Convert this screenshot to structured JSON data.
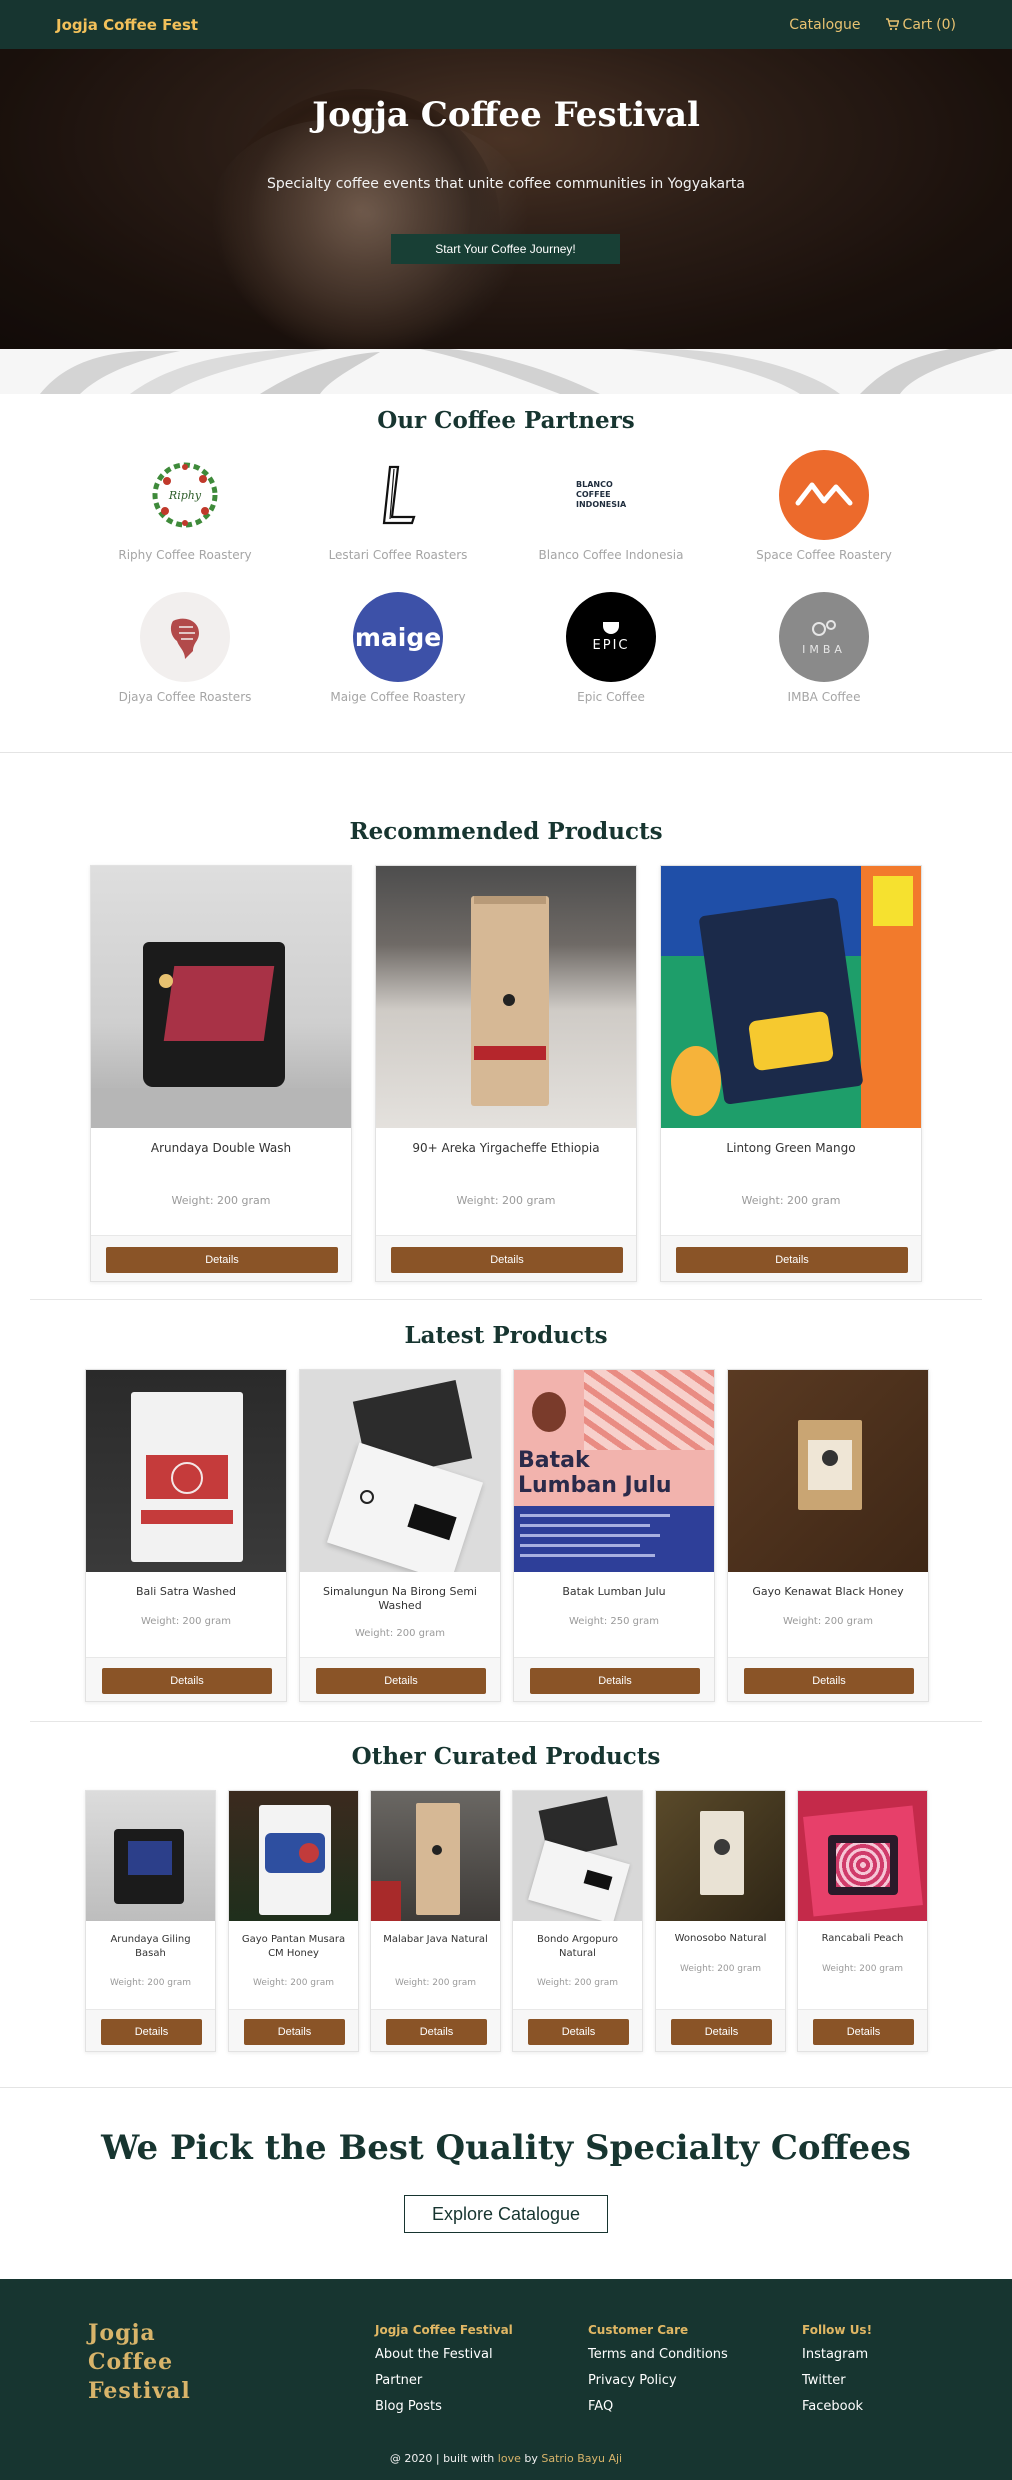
{
  "nav": {
    "brand": "Jogja Coffee Fest",
    "catalogue": "Catalogue",
    "cart_label": "Cart",
    "cart_count": "(0)"
  },
  "hero": {
    "title": "Jogja Coffee Festival",
    "subtitle": "Specialty coffee events that unite coffee communities in Yogyakarta",
    "button": "Start Your Coffee Journey!"
  },
  "partners": {
    "title": "Our Coffee Partners",
    "items": [
      {
        "name": "Riphy Coffee Roastery",
        "logo_text": "Riphy"
      },
      {
        "name": "Lestari Coffee Roasters",
        "logo_text": "L"
      },
      {
        "name": "Blanco Coffee Indonesia",
        "logo_text": "BLANCO COFFEE INDONESIA"
      },
      {
        "name": "Space Coffee Roastery",
        "logo_text": ""
      },
      {
        "name": "Djaya Coffee Roasters",
        "logo_text": ""
      },
      {
        "name": "Maige Coffee Roastery",
        "logo_text": "maige"
      },
      {
        "name": "Epic Coffee",
        "logo_text": "EPIC"
      },
      {
        "name": "IMBA Coffee",
        "logo_text": "IMBA"
      }
    ]
  },
  "recommended": {
    "title": "Recommended Products",
    "products": [
      {
        "name": "Arundaya Double Wash",
        "weight": "Weight: 200 gram",
        "button": "Details"
      },
      {
        "name": "90+ Areka Yirgacheffe Ethiopia",
        "weight": "Weight: 200 gram",
        "button": "Details"
      },
      {
        "name": "Lintong Green Mango",
        "weight": "Weight: 200 gram",
        "button": "Details"
      }
    ]
  },
  "latest": {
    "title": "Latest Products",
    "products": [
      {
        "name": "Bali Satra Washed",
        "weight": "Weight: 200 gram",
        "button": "Details"
      },
      {
        "name": "Simalungun Na Birong Semi Washed",
        "weight": "Weight: 200 gram",
        "button": "Details"
      },
      {
        "name": "Batak Lumban Julu",
        "weight": "Weight: 250 gram",
        "button": "Details"
      },
      {
        "name": "Gayo Kenawat Black Honey",
        "weight": "Weight: 200 gram",
        "button": "Details"
      }
    ]
  },
  "curated": {
    "title": "Other Curated Products",
    "products": [
      {
        "name": "Arundaya Giling Basah",
        "weight": "Weight: 200 gram",
        "button": "Details"
      },
      {
        "name": "Gayo Pantan Musara CM Honey",
        "weight": "Weight: 200 gram",
        "button": "Details"
      },
      {
        "name": "Malabar Java Natural",
        "weight": "Weight: 200 gram",
        "button": "Details"
      },
      {
        "name": "Bondo Argopuro Natural",
        "weight": "Weight: 200 gram",
        "button": "Details"
      },
      {
        "name": "Wonosobo Natural",
        "weight": "Weight: 200 gram",
        "button": "Details"
      },
      {
        "name": "Rancabali Peach",
        "weight": "Weight: 200 gram",
        "button": "Details"
      }
    ]
  },
  "cta": {
    "title": "We Pick the Best Quality Specialty Coffees",
    "button": "Explore Catalogue"
  },
  "footer": {
    "brand_line1": "Jogja",
    "brand_line2": "Coffee",
    "brand_line3": "Festival",
    "col1": {
      "title": "Jogja Coffee Festival",
      "links": [
        "About the Festival",
        "Partner",
        "Blog Posts"
      ]
    },
    "col2": {
      "title": "Customer Care",
      "links": [
        "Terms and Conditions",
        "Privacy Policy",
        "FAQ"
      ]
    },
    "col3": {
      "title": "Follow Us!",
      "links": [
        "Instagram",
        "Twitter",
        "Facebook"
      ]
    },
    "copy_prefix": "@ 2020 | built with ",
    "copy_love": "love",
    "copy_by": " by ",
    "copy_author": "Satrio Bayu Aji"
  },
  "colors": {
    "primary_dark": "#173530",
    "gold": "#e0b764",
    "button_brown": "#8a5427"
  }
}
